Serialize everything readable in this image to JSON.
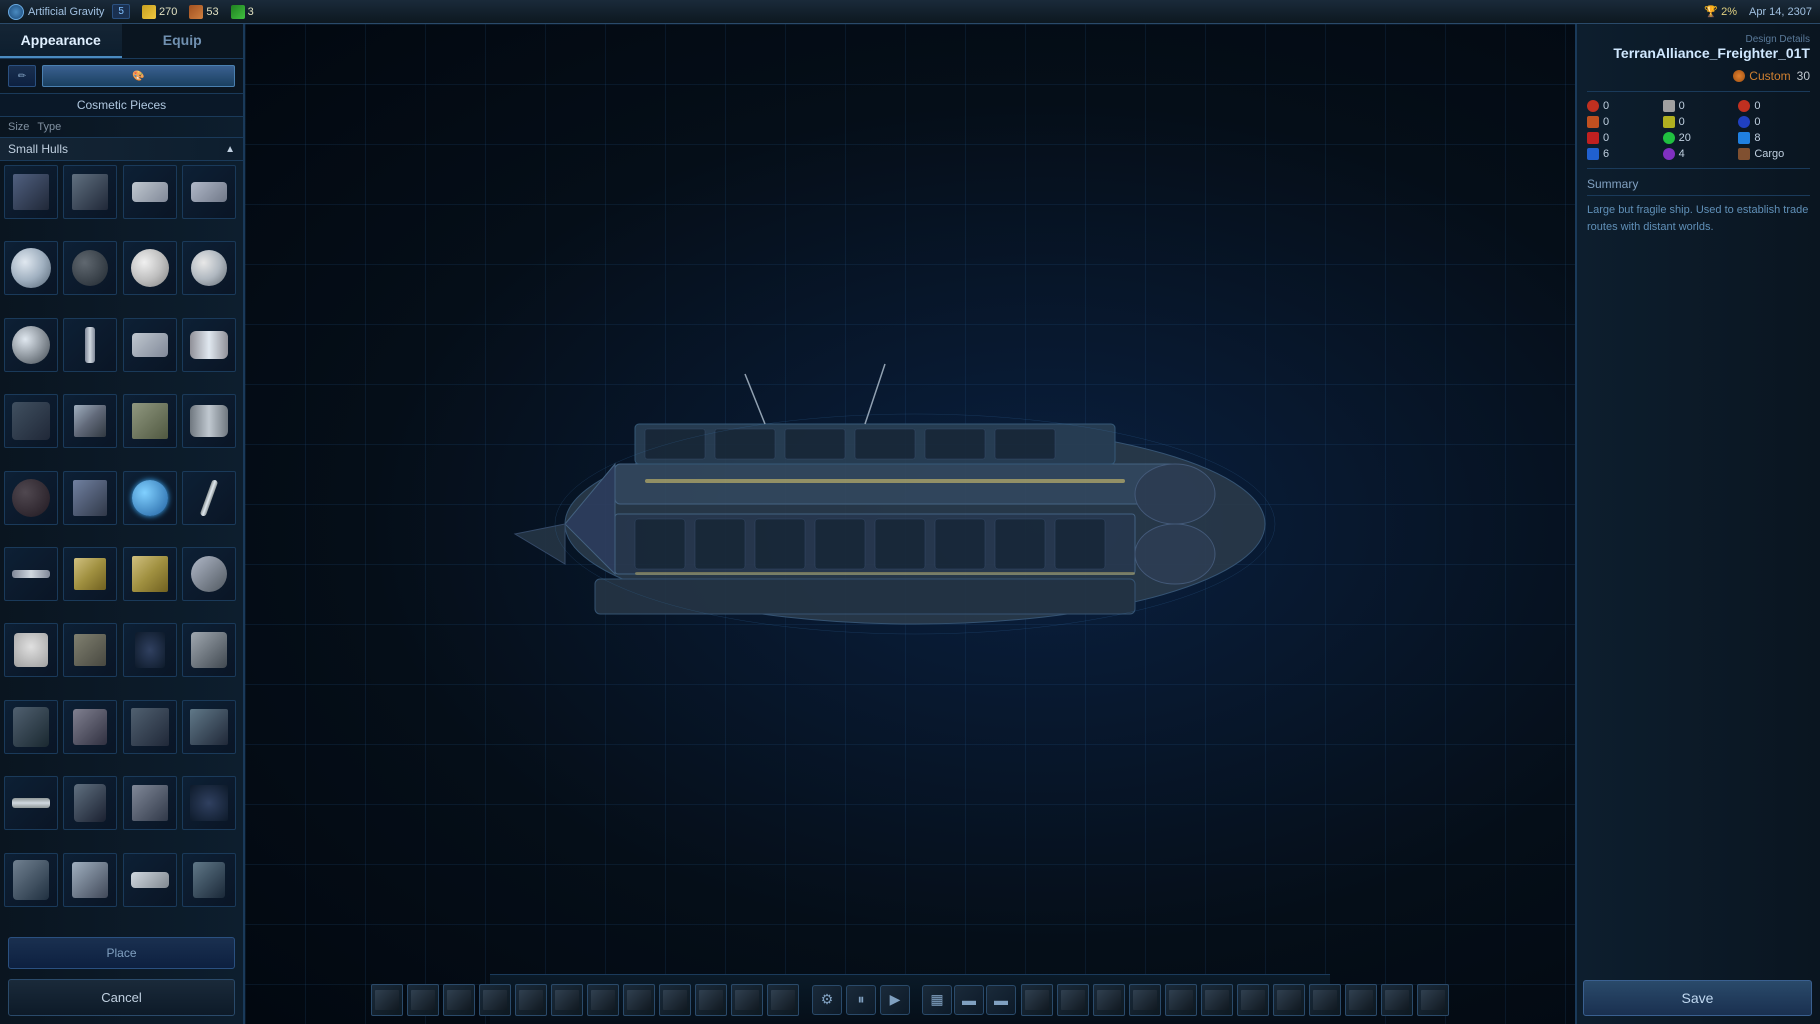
{
  "topbar": {
    "game_title": "Artificial Gravity",
    "notification_count": "5",
    "resources": [
      {
        "icon": "gold",
        "value": "270"
      },
      {
        "icon": "food",
        "value": "53"
      },
      {
        "icon": "green",
        "value": "3"
      }
    ],
    "trophy_percent": "2%",
    "date": "Apr 14, 2307"
  },
  "left_panel": {
    "tab_appearance": "Appearance",
    "tab_equip": "Equip",
    "cosmetic_label": "Cosmetic Pieces",
    "filter_size": "Size",
    "filter_type": "Type",
    "category_label": "Small Hulls",
    "place_button": "Place",
    "cancel_button": "Cancel"
  },
  "right_panel": {
    "design_details_label": "Design Details",
    "ship_name": "TerranAlliance_Freighter_01T",
    "ship_type": "Custom",
    "ship_type_number": "30",
    "stats": [
      {
        "icon": "red",
        "value": "0"
      },
      {
        "icon": "orange",
        "value": "0"
      },
      {
        "icon": "red2",
        "value": "0"
      },
      {
        "icon": "red3",
        "value": "0"
      },
      {
        "icon": "yellow",
        "value": "0"
      },
      {
        "icon": "blue2",
        "value": "0"
      },
      {
        "icon": "green2",
        "value": "0"
      },
      {
        "icon": "green3",
        "value": "20"
      },
      {
        "icon": "blue3",
        "value": "8"
      },
      {
        "icon": "blue4",
        "value": "6"
      },
      {
        "icon": "purple",
        "value": "4"
      },
      {
        "icon": "cargo",
        "value": "Cargo"
      }
    ],
    "summary_label": "Summary",
    "summary_text": "Large but fragile ship. Used to establish trade routes with distant worlds."
  },
  "bottom_toolbar": {
    "controls": [
      "⚙",
      "⏸",
      "▶"
    ],
    "view_modes": [
      "▦",
      "▬",
      "▬"
    ],
    "save_label": "Save"
  }
}
